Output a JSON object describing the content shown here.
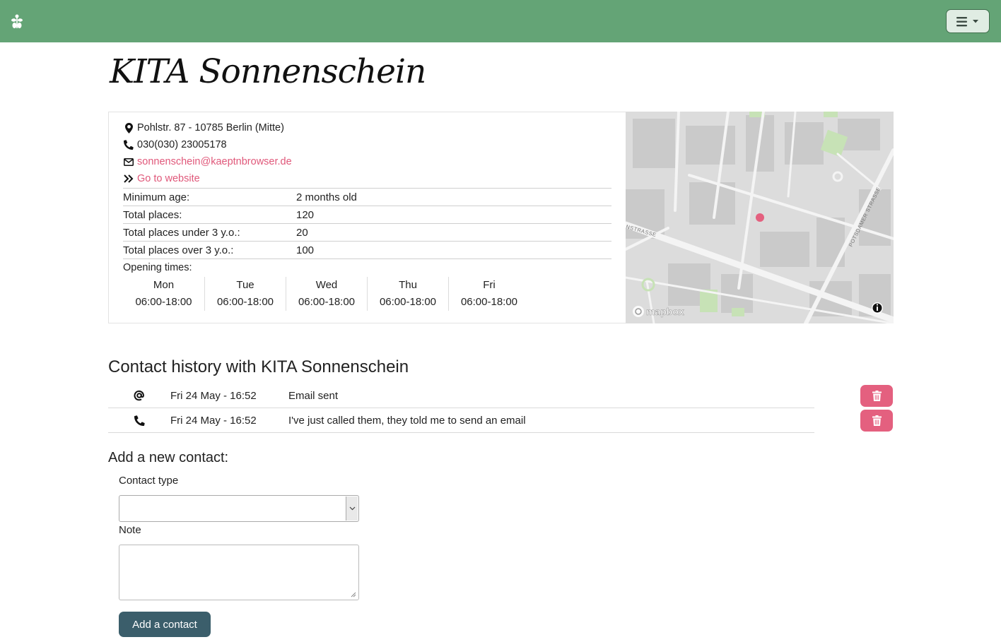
{
  "navbar": {
    "brand_icon": "sprout-logo-icon",
    "menu_icon": "hamburger-menu-icon"
  },
  "page": {
    "title": "KITA Sonnenschein"
  },
  "info": {
    "address": "Pohlstr. 87 - 10785 Berlin (Mitte)",
    "phone": "030(030) 23005178",
    "email": "sonnenschein@kaeptnbrowser.de",
    "website_label": "Go to website",
    "facts": [
      {
        "label": "Minimum age:",
        "value": "2 months old"
      },
      {
        "label": "Total places:",
        "value": "120"
      },
      {
        "label": "Total places under 3 y.o.:",
        "value": "20"
      },
      {
        "label": "Total places over 3 y.o.:",
        "value": "100"
      }
    ],
    "opening_label": "Opening times:",
    "opening_times": [
      {
        "day": "Mon",
        "hours": "06:00-18:00"
      },
      {
        "day": "Tue",
        "hours": "06:00-18:00"
      },
      {
        "day": "Wed",
        "hours": "06:00-18:00"
      },
      {
        "day": "Thu",
        "hours": "06:00-18:00"
      },
      {
        "day": "Fri",
        "hours": "06:00-18:00"
      }
    ]
  },
  "map": {
    "street_label_1": "POTSDAMER STRASSE",
    "street_label_2": "NSTRASSE",
    "attribution": "mapbox",
    "marker_color": "#e4607f"
  },
  "history": {
    "title": "Contact history with KITA Sonnenschein",
    "items": [
      {
        "icon": "at-sign-icon",
        "date": "Fri 24 May - 16:52",
        "note": "Email sent"
      },
      {
        "icon": "phone-icon",
        "date": "Fri 24 May - 16:52",
        "note": "I've just called them, they told me to send an email"
      }
    ]
  },
  "form": {
    "title": "Add a new contact:",
    "contact_type_label": "Contact type",
    "contact_type_value": "",
    "note_label": "Note",
    "note_value": "",
    "submit_label": "Add a contact"
  },
  "colors": {
    "navbar": "#64a476",
    "accent": "#e0587a",
    "delete_button": "#e4607f",
    "submit_button": "#3b5e6b"
  }
}
